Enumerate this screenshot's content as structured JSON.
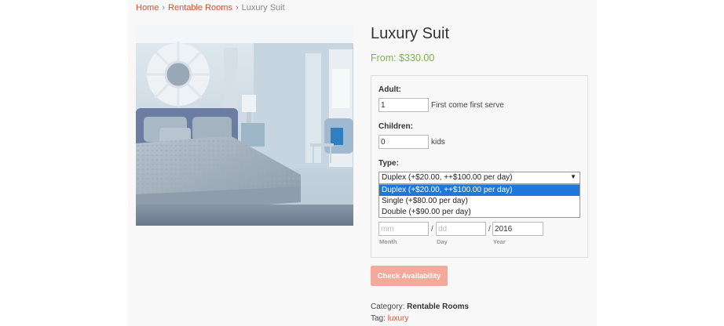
{
  "breadcrumb": {
    "home": "Home",
    "sep": "›",
    "category": "Rentable Rooms",
    "current": "Luxury Suit"
  },
  "product": {
    "title": "Luxury Suit",
    "price": "From: $330.00"
  },
  "form": {
    "adult_label": "Adult:",
    "adult_value": "1",
    "adult_hint": "First come first serve",
    "children_label": "Children:",
    "children_value": "0",
    "children_hint": "kids",
    "type_label": "Type:",
    "type_selected": "Duplex (+$20.00, ++$100.00 per day)",
    "type_options": [
      "Duplex (+$20.00, ++$100.00 per day)",
      "Single (+$80.00 per day)",
      "Double (+$90.00 per day)"
    ],
    "date": {
      "mm_placeholder": "mm",
      "dd_placeholder": "dd",
      "year_value": "2016",
      "separator": "/",
      "month_label": "Month",
      "day_label": "Day",
      "year_label": "Year"
    }
  },
  "button": {
    "check_label": "Check Availability"
  },
  "meta": {
    "category_label": "Category:",
    "category_value": "Rentable Rooms",
    "tag_label": "Tag:",
    "tag_value": "luxury"
  },
  "colors": {
    "accent": "#e04d2a",
    "price_green": "#7cb342",
    "button": "#f4a99b",
    "option_highlight": "#1e78dc"
  }
}
